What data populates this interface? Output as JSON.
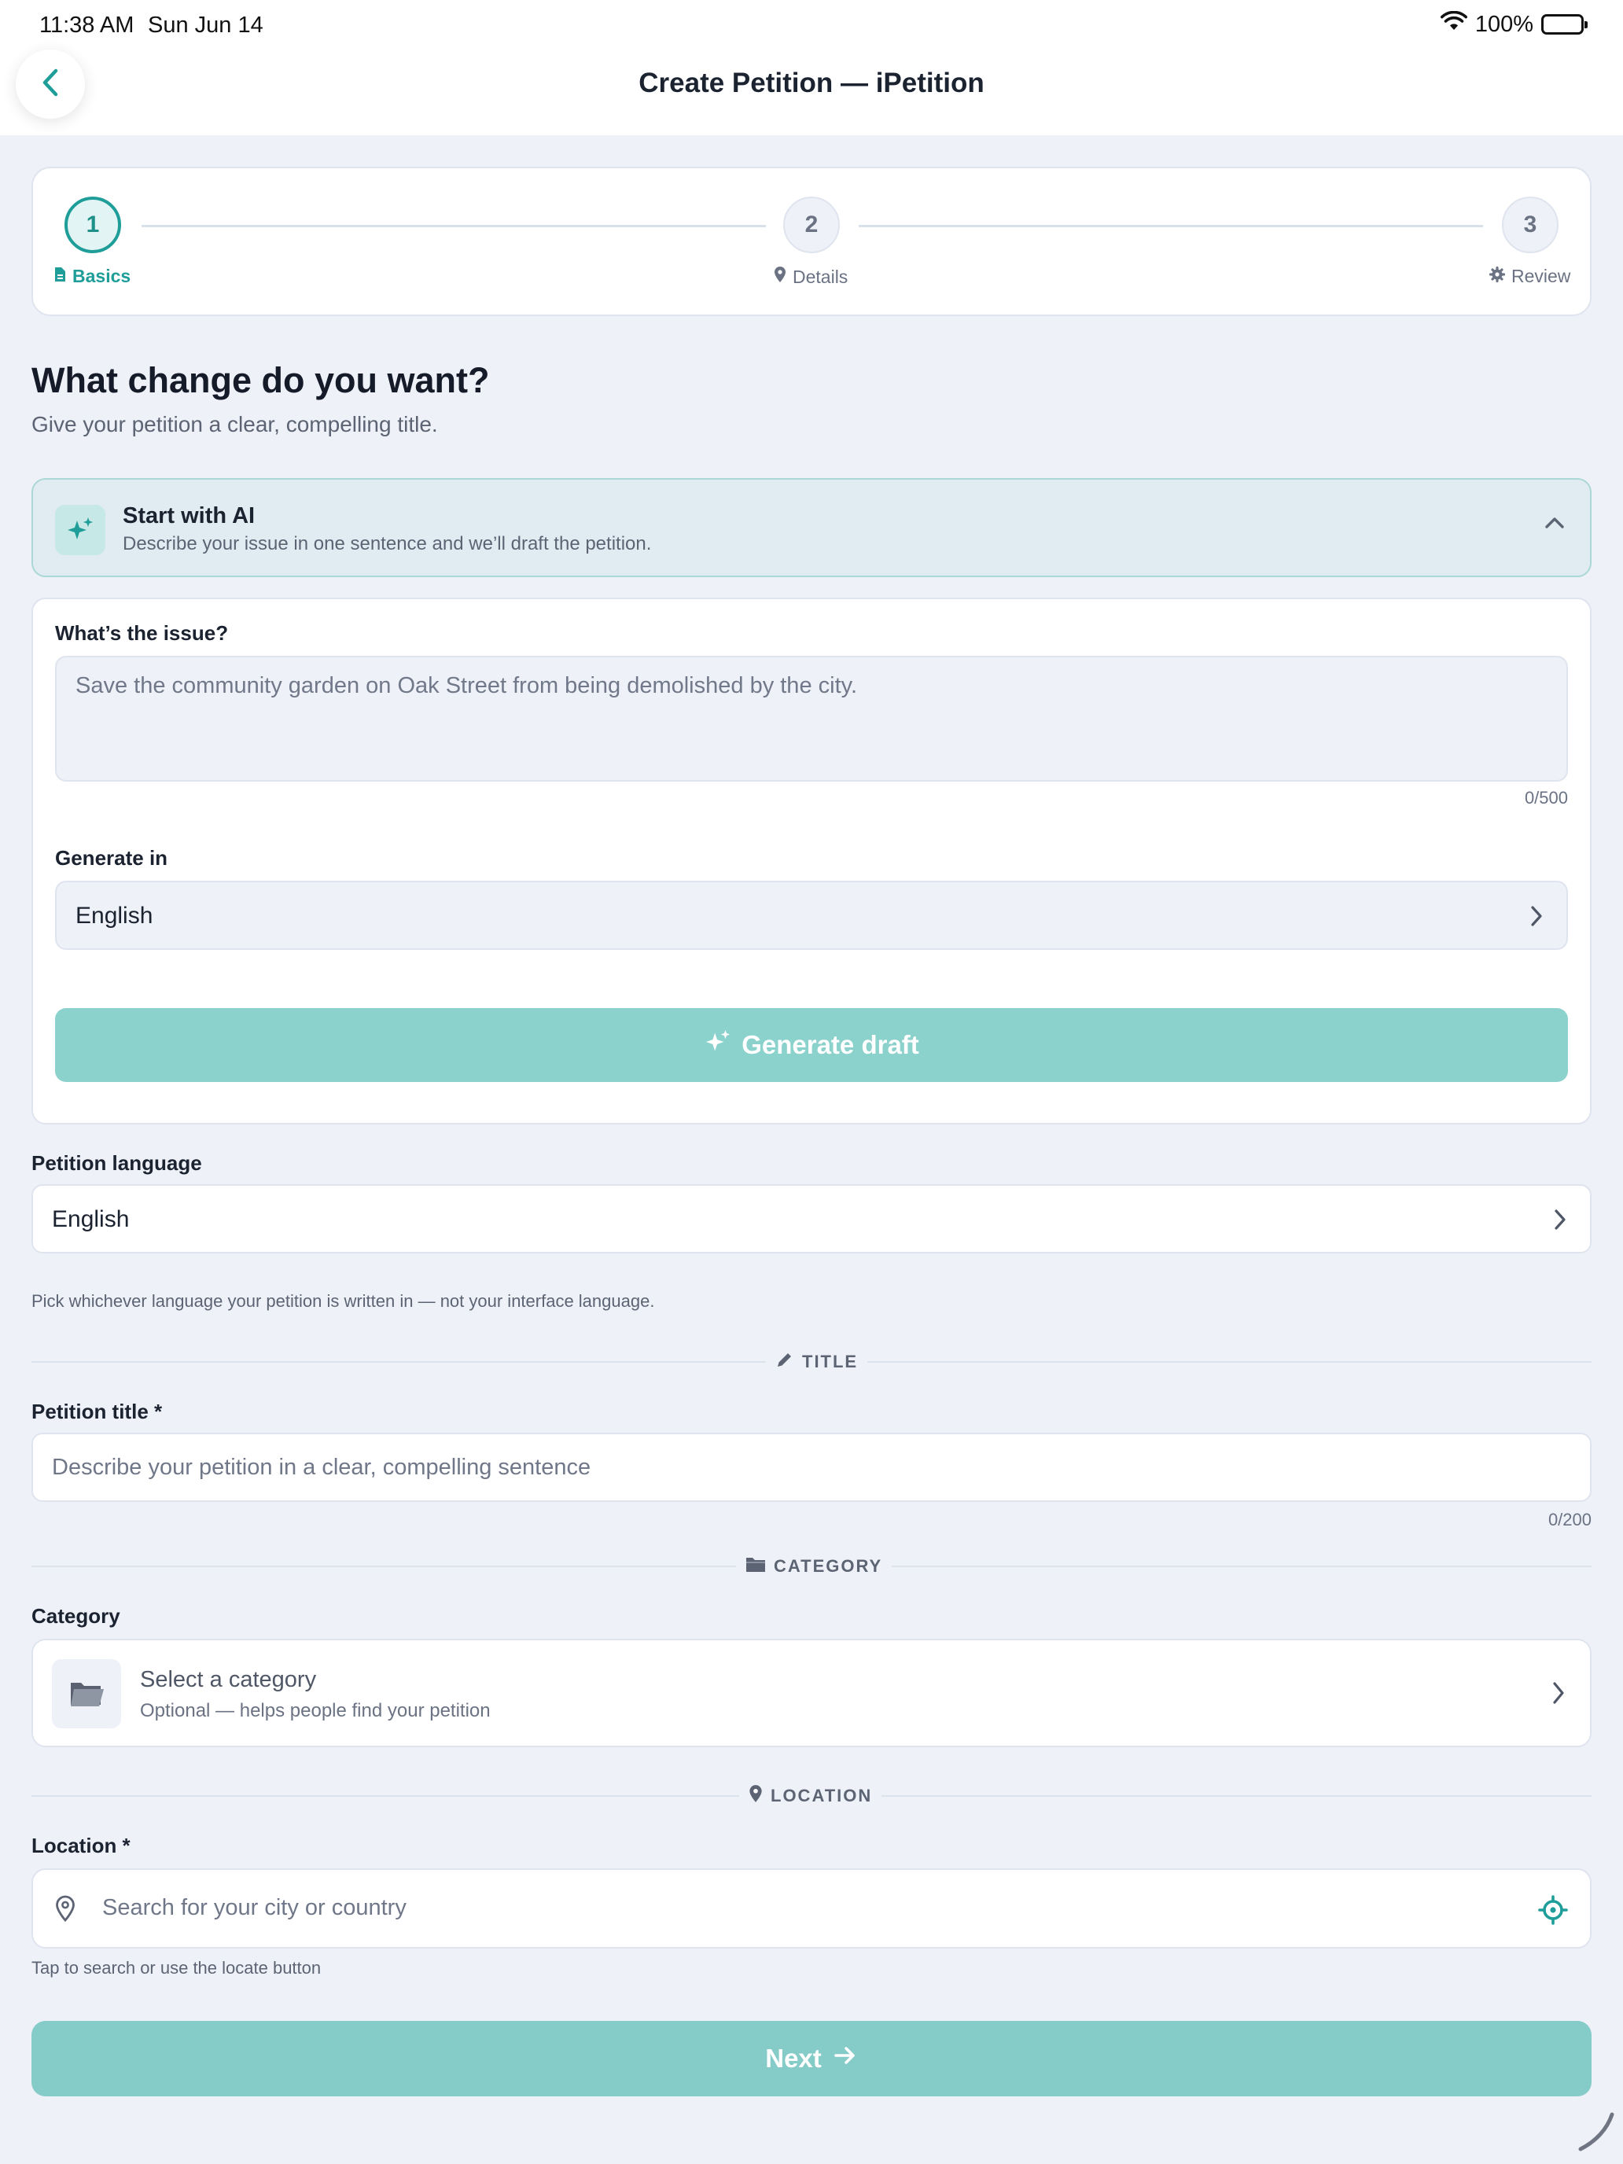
{
  "status_bar": {
    "time": "11:38 AM",
    "date": "Sun Jun 14",
    "battery": "100%"
  },
  "header": {
    "title": "Create Petition — iPetition"
  },
  "stepper": {
    "steps": [
      {
        "number": "1",
        "label": "Basics",
        "icon": "document-icon",
        "state": "active"
      },
      {
        "number": "2",
        "label": "Details",
        "icon": "pin-icon",
        "state": "inactive"
      },
      {
        "number": "3",
        "label": "Review",
        "icon": "gear-icon",
        "state": "inactive"
      }
    ]
  },
  "intro": {
    "heading": "What change do you want?",
    "subheading": "Give your petition a clear, compelling title."
  },
  "ai": {
    "title": "Start with AI",
    "description": "Describe your issue in one sentence and we’ll draft the petition.",
    "issue_label": "What’s the issue?",
    "issue_placeholder": "Save the community garden on Oak Street from being demolished by the city.",
    "issue_counter": "0/500",
    "generate_in_label": "Generate in",
    "generate_in_value": "English",
    "generate_button": "Generate draft"
  },
  "petition_language": {
    "label": "Petition language",
    "value": "English",
    "hint": "Pick whichever language your petition is written in — not your interface language."
  },
  "title_section": {
    "divider": "TITLE",
    "label": "Petition title *",
    "placeholder": "Describe your petition in a clear, compelling sentence",
    "counter": "0/200"
  },
  "category_section": {
    "divider": "CATEGORY",
    "label": "Category",
    "title": "Select a category",
    "subtitle": "Optional — helps people find your petition"
  },
  "location_section": {
    "divider": "LOCATION",
    "label": "Location *",
    "placeholder": "Search for your city or country",
    "hint": "Tap to search or use the locate button"
  },
  "footer": {
    "next_button": "Next"
  },
  "colors": {
    "accent": "#1f9e99",
    "button_disabled": "#8bd1cc",
    "background": "#eef1f8"
  }
}
